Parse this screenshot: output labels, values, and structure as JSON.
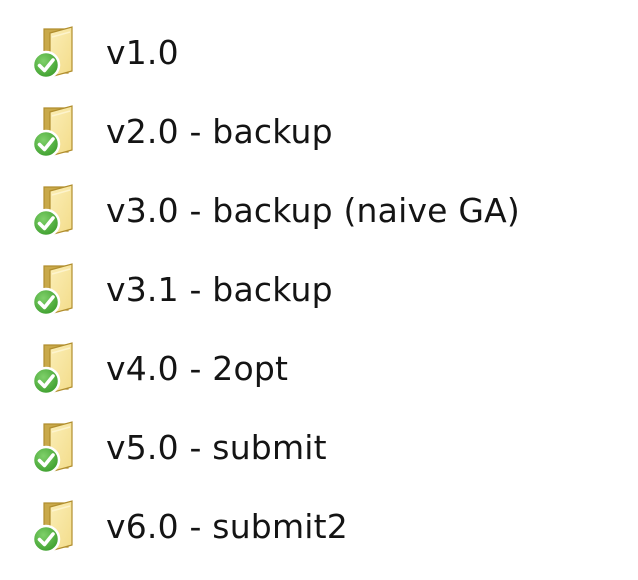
{
  "folders": [
    {
      "name": "v1.0",
      "icon": "folder-icon",
      "overlay": "sync-check-icon"
    },
    {
      "name": "v2.0 - backup",
      "icon": "folder-icon",
      "overlay": "sync-check-icon"
    },
    {
      "name": "v3.0 - backup (naive GA)",
      "icon": "folder-icon",
      "overlay": "sync-check-icon"
    },
    {
      "name": "v3.1 - backup",
      "icon": "folder-icon",
      "overlay": "sync-check-icon"
    },
    {
      "name": "v4.0 - 2opt",
      "icon": "folder-icon",
      "overlay": "sync-check-icon"
    },
    {
      "name": "v5.0 - submit",
      "icon": "folder-icon",
      "overlay": "sync-check-icon"
    },
    {
      "name": "v6.0 - submit2",
      "icon": "folder-icon",
      "overlay": "sync-check-icon"
    }
  ],
  "colors": {
    "folder_back": "#c9a94a",
    "folder_front": "#f3dc8a",
    "folder_edge": "#b18e2e",
    "check_green": "#3a9c2a",
    "check_green_light": "#7fd06a",
    "text": "#141414"
  }
}
